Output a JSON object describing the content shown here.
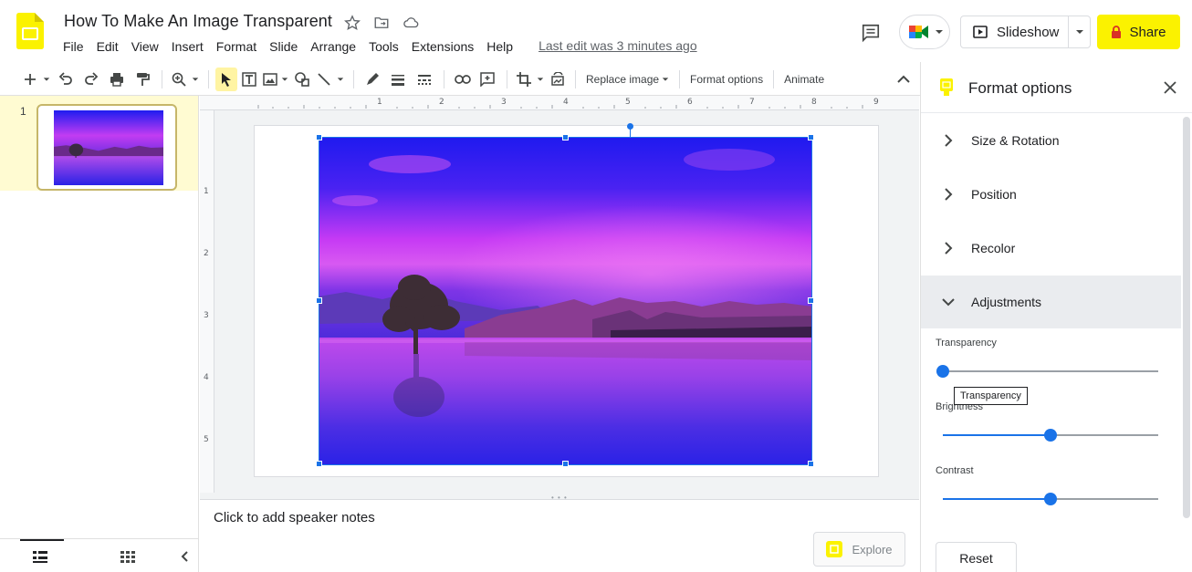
{
  "app": {
    "doc_title": "How To Make An Image Transparent",
    "menu": [
      "File",
      "Edit",
      "View",
      "Insert",
      "Format",
      "Slide",
      "Arrange",
      "Tools",
      "Extensions",
      "Help"
    ],
    "last_edit": "Last edit was 3 minutes ago",
    "slideshow_label": "Slideshow",
    "share_label": "Share",
    "brand_color": "#fbf200",
    "accent_color": "#1a73e8"
  },
  "toolbar": {
    "replace_image": "Replace image",
    "format_options": "Format options",
    "animate": "Animate"
  },
  "filmstrip": {
    "slides": [
      {
        "number": "1"
      }
    ]
  },
  "ruler": {
    "h_labels": [
      "1",
      "2",
      "3",
      "4",
      "5",
      "6",
      "7",
      "8",
      "9"
    ],
    "v_labels": [
      "1",
      "2",
      "3",
      "4",
      "5"
    ]
  },
  "notes": {
    "placeholder": "Click to add speaker notes",
    "explore_label": "Explore"
  },
  "panel": {
    "title": "Format options",
    "sections": [
      {
        "label": "Size & Rotation",
        "expanded": false
      },
      {
        "label": "Position",
        "expanded": false
      },
      {
        "label": "Recolor",
        "expanded": false
      },
      {
        "label": "Adjustments",
        "expanded": true
      }
    ],
    "sliders": [
      {
        "label": "Transparency",
        "value": 0
      },
      {
        "label": "Brightness",
        "value": 0.5
      },
      {
        "label": "Contrast",
        "value": 0.5
      }
    ],
    "tooltip": "Transparency",
    "reset_label": "Reset"
  }
}
